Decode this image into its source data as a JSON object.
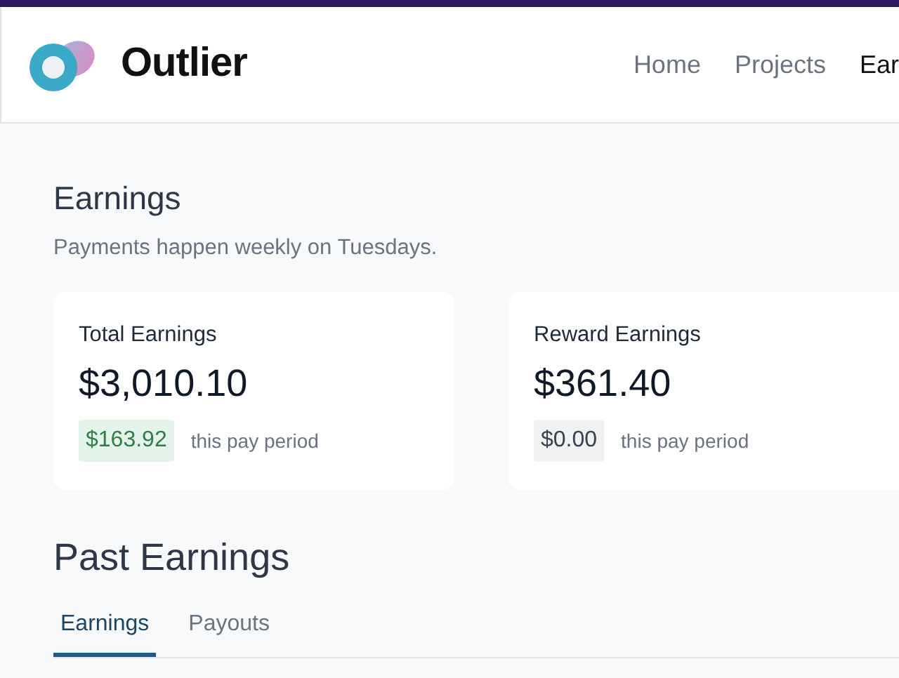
{
  "header": {
    "brand": "Outlier",
    "nav": [
      {
        "label": "Home",
        "selected": false
      },
      {
        "label": "Projects",
        "selected": false
      },
      {
        "label": "Ear",
        "selected": true
      }
    ]
  },
  "page": {
    "title": "Earnings",
    "subtitle": "Payments happen weekly on Tuesdays."
  },
  "cards": [
    {
      "title": "Total Earnings",
      "amount": "$3,010.10",
      "period_amount": "$163.92",
      "kind": "positive",
      "period_label": "this pay period"
    },
    {
      "title": "Reward Earnings",
      "amount": "$361.40",
      "period_amount": "$0.00",
      "kind": "neutral",
      "period_label": "this pay period"
    }
  ],
  "past": {
    "title": "Past Earnings",
    "tabs": [
      {
        "label": "Earnings",
        "selected": true
      },
      {
        "label": "Payouts",
        "selected": false
      }
    ]
  }
}
